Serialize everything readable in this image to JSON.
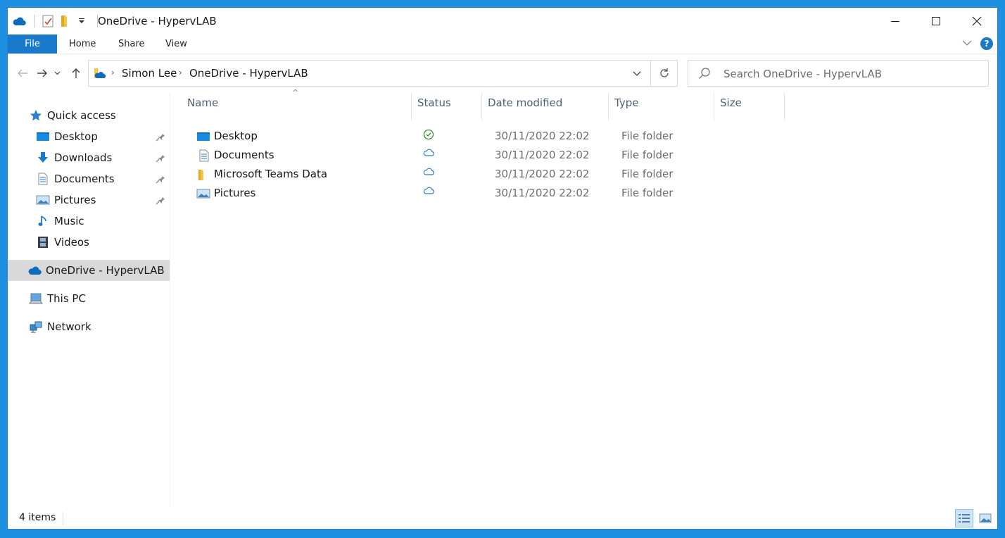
{
  "window": {
    "title": "OneDrive - HypervLAB"
  },
  "ribbon": {
    "tabs": {
      "file": "File",
      "home": "Home",
      "share": "Share",
      "view": "View"
    },
    "help": "?"
  },
  "address": {
    "crumbs": [
      "Simon Lee",
      "OneDrive - HypervLAB"
    ]
  },
  "search": {
    "placeholder": "Search OneDrive - HypervLAB"
  },
  "nav": {
    "quick_access": "Quick access",
    "items": {
      "desktop": "Desktop",
      "downloads": "Downloads",
      "documents": "Documents",
      "pictures": "Pictures",
      "music": "Music",
      "videos": "Videos"
    },
    "onedrive": "OneDrive - HypervLAB",
    "this_pc": "This PC",
    "network": "Network"
  },
  "columns": {
    "name": "Name",
    "status": "Status",
    "date": "Date modified",
    "type": "Type",
    "size": "Size"
  },
  "files": [
    {
      "name": "Desktop",
      "status": "synced",
      "date": "30/11/2020 22:02",
      "type": "File folder"
    },
    {
      "name": "Documents",
      "status": "cloud",
      "date": "30/11/2020 22:02",
      "type": "File folder"
    },
    {
      "name": "Microsoft Teams Data",
      "status": "cloud",
      "date": "30/11/2020 22:02",
      "type": "File folder"
    },
    {
      "name": "Pictures",
      "status": "cloud",
      "date": "30/11/2020 22:02",
      "type": "File folder"
    }
  ],
  "statusbar": {
    "count": "4 items"
  },
  "colors": {
    "accent": "#1979ca",
    "onedrive": "#0f6cbd",
    "synced": "#2f8f3c"
  }
}
